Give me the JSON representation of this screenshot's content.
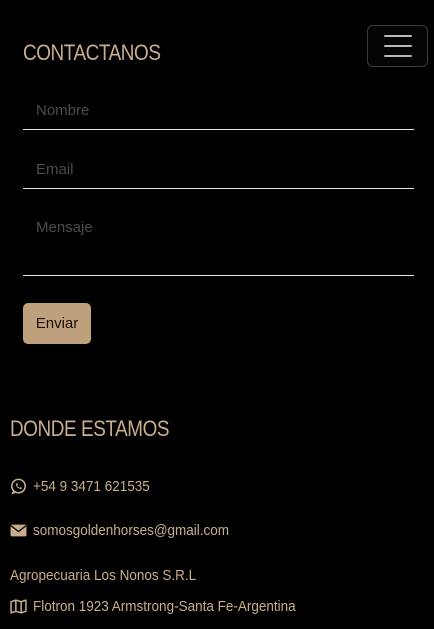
{
  "navbar": {
    "toggler_icon": "hamburger-menu-icon"
  },
  "contact": {
    "title": "CONTACTANOS",
    "name_placeholder": "Nombre",
    "email_placeholder": "Email",
    "message_placeholder": "Mensaje",
    "submit_label": "Enviar"
  },
  "location": {
    "title": "DONDE ESTAMOS",
    "phone": "+54 9 3471 621535",
    "phone_icon": "whatsapp-icon",
    "email": "somosgoldenhorses@gmail.com",
    "email_icon": "envelope-icon",
    "company": "Agropecuaria Los Nonos S.R.L",
    "address": "Flotron 1923 Armstrong-Santa Fe-Argentina",
    "address_icon": "map-icon"
  },
  "colors": {
    "background": "#000000",
    "accent": "#c8ae8c",
    "button": "#bfa07d",
    "underline": "#e5e5e5"
  }
}
